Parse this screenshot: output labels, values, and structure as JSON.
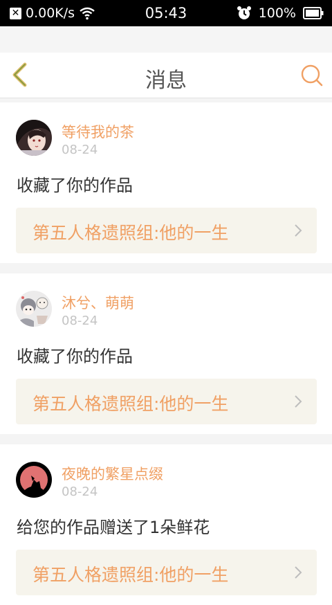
{
  "status_bar": {
    "network_speed": "0.00K/s",
    "time": "05:43",
    "battery": "100%"
  },
  "header": {
    "title": "消息",
    "back_icon": "chevron-left-icon",
    "search_icon": "search-icon"
  },
  "colors": {
    "accent": "#f0a064",
    "text": "#333333",
    "muted": "#c4c4c4",
    "link_bg": "#f6f4ec"
  },
  "messages": [
    {
      "user": "等待我的茶",
      "date": "08-24",
      "action": "收藏了你的作品",
      "work_title": "第五人格遗照组:他的一生"
    },
    {
      "user": "沐兮、萌萌",
      "date": "08-24",
      "action": "收藏了你的作品",
      "work_title": "第五人格遗照组:他的一生"
    },
    {
      "user": "夜晚的繁星点缀",
      "date": "08-24",
      "action": "给您的作品赠送了1朵鲜花",
      "work_title": "第五人格遗照组:他的一生"
    }
  ]
}
